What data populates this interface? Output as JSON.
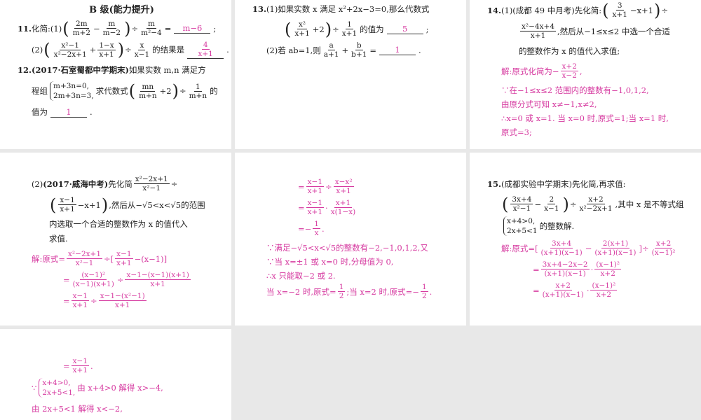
{
  "accent_color": "#d63aa0",
  "panels": {
    "p1": [
      {
        "s": [
          {
            "bold": "B 级(能力提升)"
          }
        ]
      },
      {
        "s": [
          {
            "bold": "11."
          },
          "化简:(1)",
          {
            "p": "("
          },
          {
            "f": [
              "2m",
              "m+2"
            ]
          },
          "−",
          {
            "f": [
              "m",
              "m−2"
            ]
          },
          {
            "p": ")"
          },
          "÷",
          {
            "f": [
              "m",
              "m²−4"
            ]
          },
          "=",
          {
            "b": "m−6"
          },
          ";"
        ]
      },
      {
        "s": [
          "(2)",
          {
            "p": "("
          },
          {
            "f": [
              "x²−1",
              "x²−2x+1"
            ]
          },
          "+",
          {
            "f": [
              "1−x",
              "x+1"
            ]
          },
          {
            "p": ")"
          },
          "÷",
          {
            "f": [
              "x",
              "x−1"
            ]
          },
          "的结果是",
          {
            "b": {
              "f": [
                "4",
                "x+1"
              ]
            }
          },
          "."
        ]
      },
      {
        "s": [
          {
            "bold": "12.(2017·石室蜀都中学期末)"
          },
          "如果实数 m,n 满足方"
        ]
      },
      {
        "s": [
          "程组",
          {
            "sys": [
              "m+3n=0,",
              "2m+3n=3,"
            ]
          },
          "求代数式",
          {
            "p": "("
          },
          {
            "f": [
              "mn",
              "m+n"
            ]
          },
          "+2",
          {
            "p": ")"
          },
          "÷",
          {
            "f": [
              "1",
              "m+n"
            ]
          },
          "的"
        ]
      },
      {
        "s": [
          "值为",
          {
            "b": "1"
          },
          "."
        ]
      }
    ],
    "p2": [
      {
        "s": [
          {
            "bold": "13."
          },
          "(1)如果实数 x 满足 x²+2x−3=0,那么代数式"
        ]
      },
      {
        "s": [
          {
            "p": "("
          },
          {
            "f": [
              "x²",
              "x+1"
            ]
          },
          "+2",
          {
            "p": ")"
          },
          "÷",
          {
            "f": [
              "1",
              "x+1"
            ]
          },
          "的值为",
          {
            "b": "5"
          },
          ";"
        ]
      },
      {
        "s": [
          "(2)若 ab=1,则",
          {
            "f": [
              "a",
              "a+1"
            ]
          },
          "+",
          {
            "f": [
              "b",
              "b+1"
            ]
          },
          "=",
          {
            "b": "1"
          },
          "."
        ]
      }
    ],
    "p3": [
      {
        "s": [
          {
            "bold": "14."
          },
          "(1)(成都 49 中月考)先化简:",
          {
            "p": "("
          },
          {
            "f": [
              "3",
              "x+1"
            ]
          },
          "−x+1",
          {
            "p": ")"
          },
          "÷"
        ]
      },
      {
        "s": [
          {
            "f": [
              "x²−4x+4",
              "x+1"
            ]
          },
          ",然后从−1≤x≤2 中选一个合适"
        ]
      },
      {
        "s": [
          "的整数作为 x 的值代入求值;"
        ]
      },
      {
        "answer": true,
        "s": [
          "解:原式化简为−",
          {
            "f": [
              "x+2",
              "x−2"
            ]
          },
          ","
        ]
      },
      {
        "answer": true,
        "s": [
          "∵在−1≤x≤2 范围内的整数有−1,0,1,2,"
        ]
      },
      {
        "answer": true,
        "s": [
          "由原分式可知 x≠−1,x≠2,"
        ]
      },
      {
        "answer": true,
        "s": [
          "∴x=0 或 x=1. 当 x=0 时,原式=1;当 x=1 时,"
        ]
      },
      {
        "answer": true,
        "s": [
          "原式=3;"
        ]
      }
    ],
    "p4": [
      {
        "s": [
          "(2)",
          {
            "bold": "(2017·威海中考)"
          },
          "先化简",
          {
            "f": [
              "x²−2x+1",
              "x²−1"
            ]
          },
          "÷"
        ]
      },
      {
        "s": [
          {
            "p": "("
          },
          {
            "f": [
              "x−1",
              "x+1"
            ]
          },
          "−x+1",
          {
            "p": ")"
          },
          ",然后从−√5<x<√5的范围"
        ]
      },
      {
        "s": [
          "内选取一个合适的整数作为 x 的值代入"
        ]
      },
      {
        "s": [
          "求值."
        ]
      },
      {
        "answer": true,
        "s": [
          "解:原式=",
          {
            "f": [
              "x²−2x+1",
              "x²−1"
            ]
          },
          "÷[",
          {
            "f": [
              "x−1",
              "x+1"
            ]
          },
          "−(x−1)]"
        ]
      },
      {
        "answer": true,
        "s": [
          "=",
          {
            "f": [
              "(x−1)²",
              "(x−1)(x+1)"
            ]
          },
          "÷",
          {
            "f": [
              "x−1−(x−1)(x+1)",
              "x+1"
            ]
          }
        ]
      },
      {
        "answer": true,
        "s": [
          "=",
          {
            "f": [
              "x−1",
              "x+1"
            ]
          },
          "÷",
          {
            "f": [
              "x−1−(x²−1)",
              "x+1"
            ]
          }
        ]
      }
    ],
    "p5": [
      {
        "answer": true,
        "s": [
          "=",
          {
            "f": [
              "x−1",
              "x+1"
            ]
          },
          "÷",
          {
            "f": [
              "x−x²",
              "x+1"
            ]
          }
        ]
      },
      {
        "answer": true,
        "s": [
          "=",
          {
            "f": [
              "x−1",
              "x+1"
            ]
          },
          "·",
          {
            "f": [
              "x+1",
              "x(1−x)"
            ]
          }
        ]
      },
      {
        "answer": true,
        "s": [
          "=−",
          {
            "f": [
              "1",
              "x"
            ]
          },
          "."
        ]
      },
      {
        "answer": true,
        "s": [
          "∵满足−√5<x<√5的整数有−2,−1,0,1,2,又"
        ]
      },
      {
        "answer": true,
        "s": [
          "∵当 x=±1 或 x=0 时,分母值为 0,"
        ]
      },
      {
        "answer": true,
        "s": [
          "∴x 只能取−2 或 2."
        ]
      },
      {
        "answer": true,
        "s": [
          "当 x=−2 时,原式=",
          {
            "f": [
              "1",
              "2"
            ]
          },
          ";当 x=2 时,原式=−",
          {
            "f": [
              "1",
              "2"
            ]
          },
          "."
        ]
      }
    ],
    "p6": [
      {
        "s": [
          {
            "bold": "15."
          },
          "(成都实验中学期末)先化简,再求值:"
        ]
      },
      {
        "s": [
          {
            "p": "("
          },
          {
            "f": [
              "3x+4",
              "x²−1"
            ]
          },
          "−",
          {
            "f": [
              "2",
              "x−1"
            ]
          },
          {
            "p": ")"
          },
          "÷",
          {
            "f": [
              "x+2",
              "x²−2x+1"
            ]
          },
          ",其中 x 是不等式组"
        ]
      },
      {
        "s": [
          {
            "sys": [
              "x+4>0,",
              "2x+5<1"
            ]
          },
          "的整数解."
        ]
      },
      {
        "answer": true,
        "s": [
          "解:原式=[",
          {
            "f": [
              "3x+4",
              "(x+1)(x−1)"
            ]
          },
          "−",
          {
            "f": [
              "2(x+1)",
              "(x+1)(x−1)"
            ]
          },
          "]÷",
          {
            "f": [
              "x+2",
              "(x−1)²"
            ]
          }
        ]
      },
      {
        "answer": true,
        "s": [
          "=",
          {
            "f": [
              "3x+4−2x−2",
              "(x+1)(x−1)"
            ]
          },
          "·",
          {
            "f": [
              "(x−1)²",
              "x+2"
            ]
          }
        ]
      },
      {
        "answer": true,
        "s": [
          "=",
          {
            "f": [
              "x+2",
              "(x+1)(x−1)"
            ]
          },
          "·",
          {
            "f": [
              "(x−1)²",
              "x+2"
            ]
          }
        ]
      }
    ],
    "p7": [
      {
        "answer": true,
        "s": [
          "=",
          {
            "f": [
              "x−1",
              "x+1"
            ]
          },
          "."
        ]
      },
      {
        "answer": true,
        "s": [
          "∵",
          {
            "sys": [
              "x+4>0,",
              "2x+5<1,"
            ]
          },
          "由 x+4>0 解得 x>−4,"
        ]
      },
      {
        "answer": true,
        "s": [
          "由 2x+5<1 解得 x<−2,"
        ]
      }
    ]
  }
}
